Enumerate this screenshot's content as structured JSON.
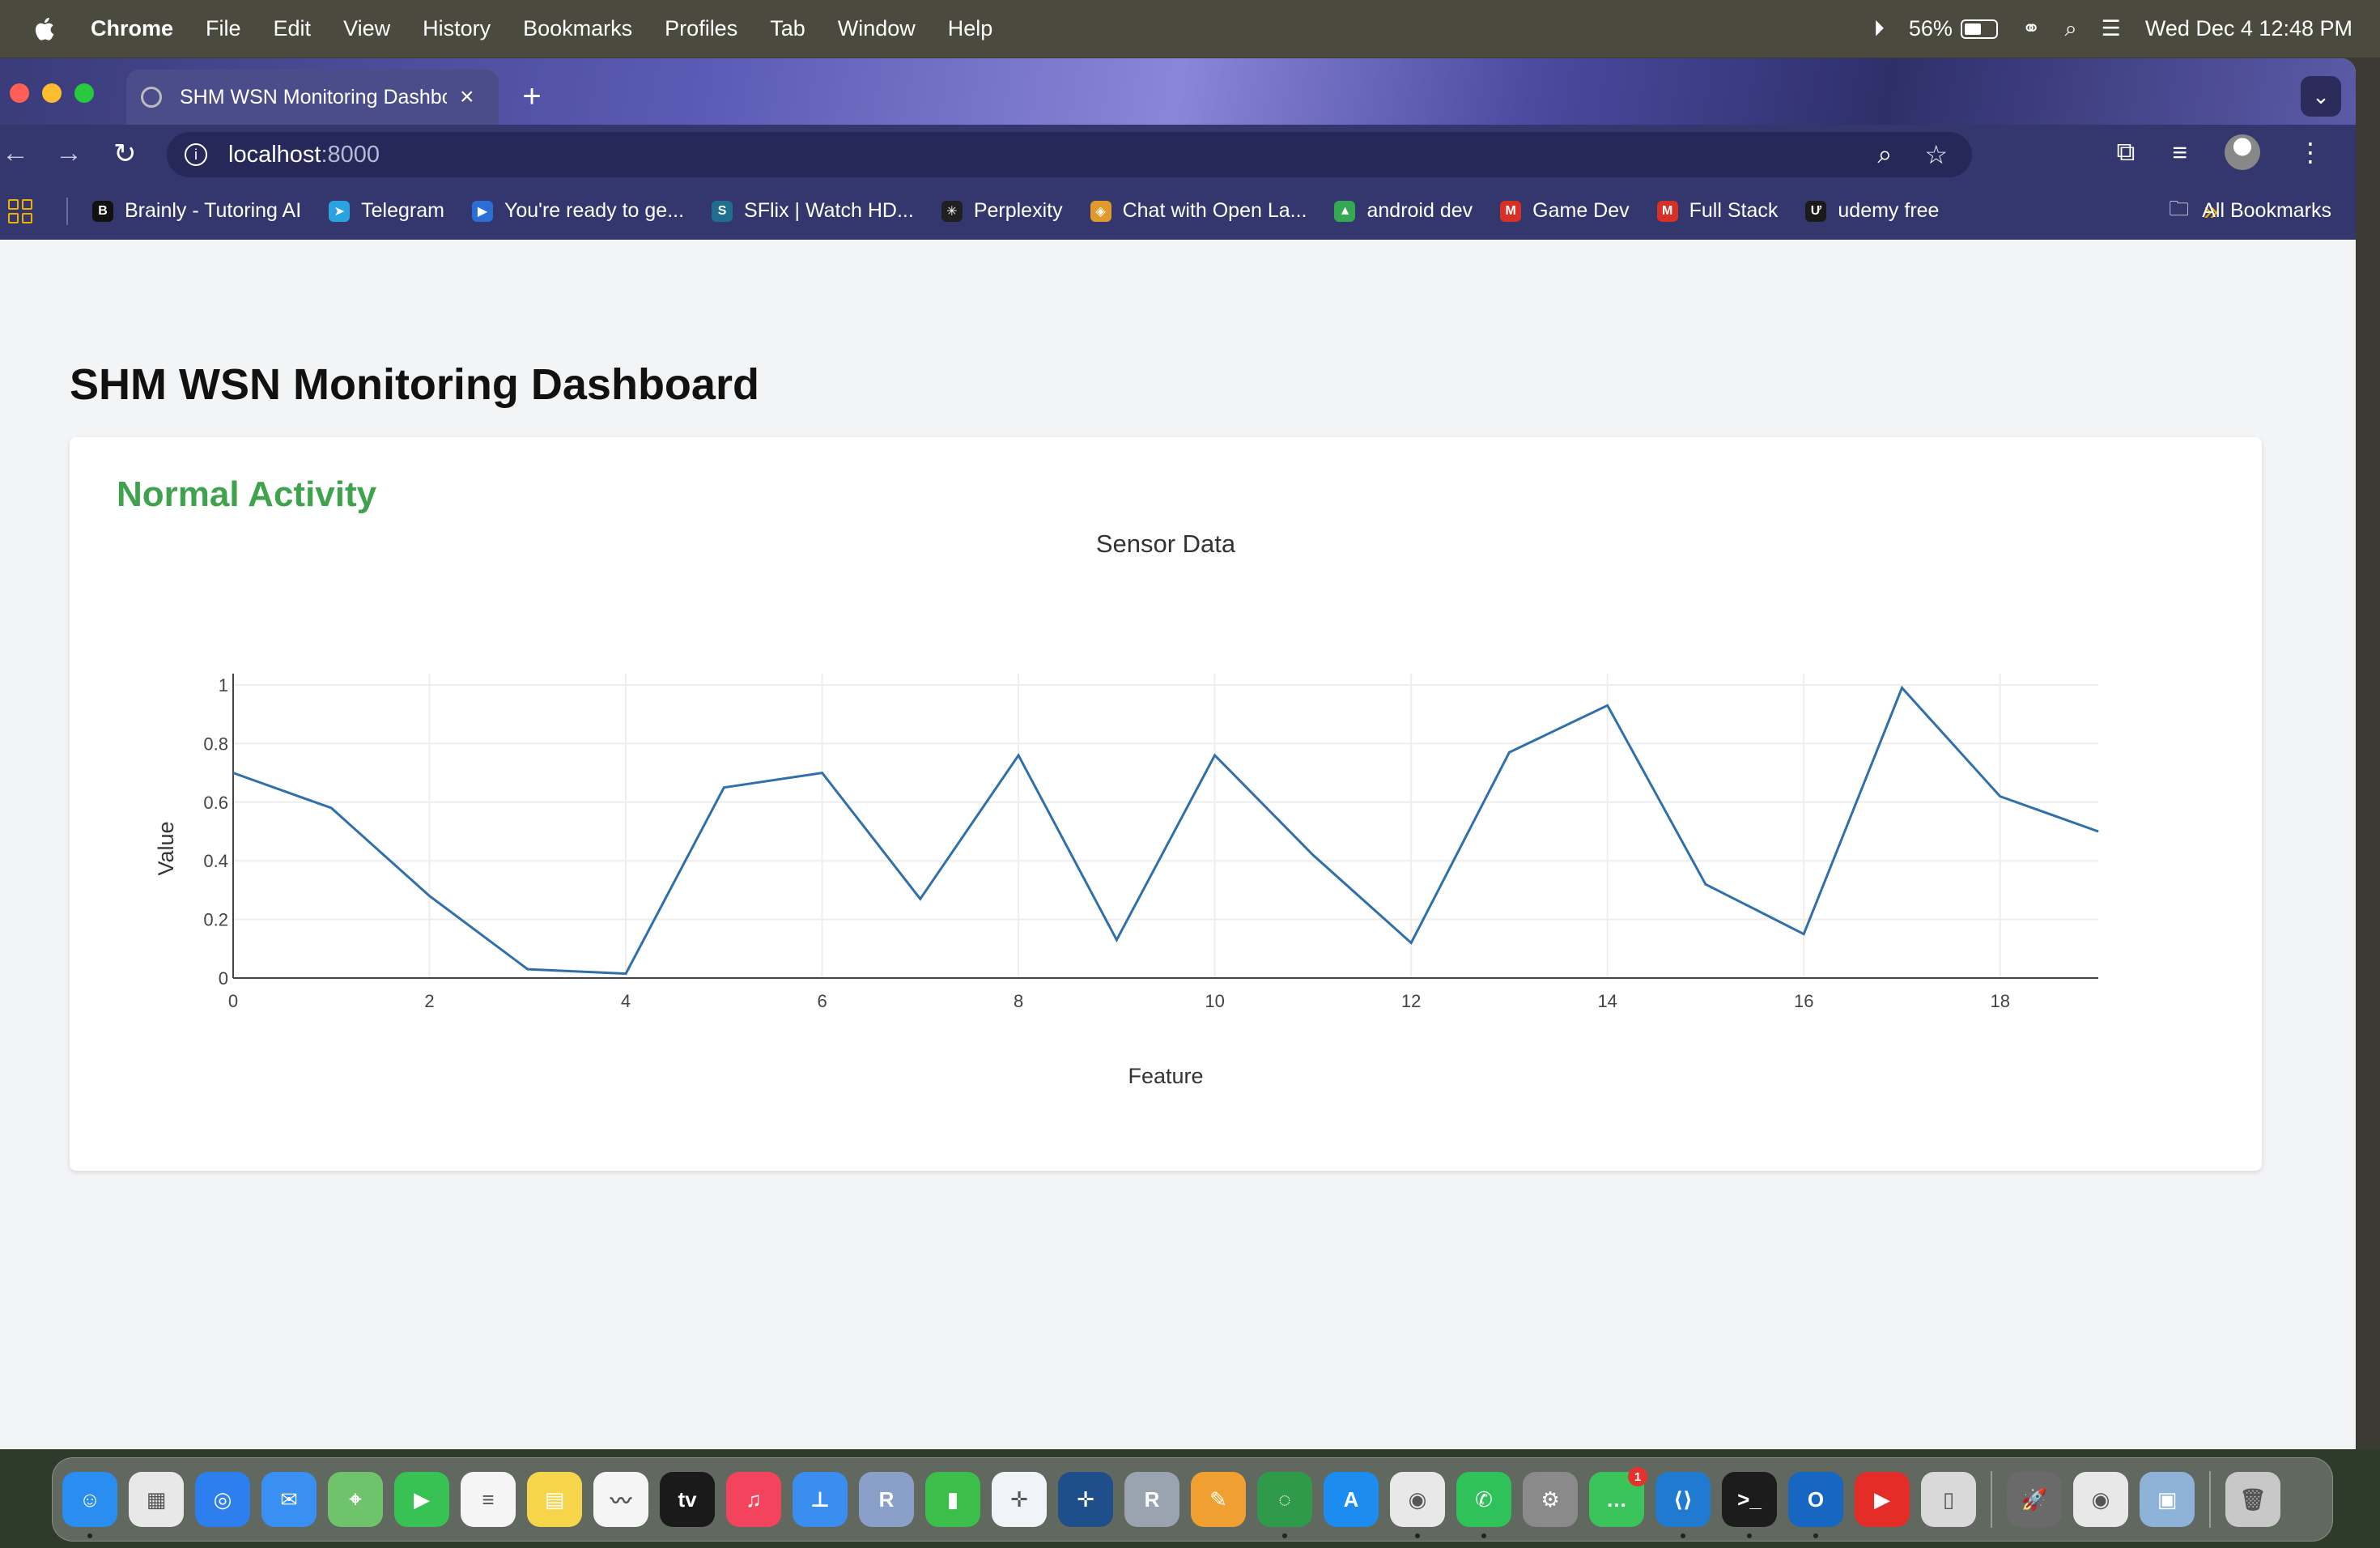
{
  "menubar": {
    "app_name": "Chrome",
    "items": [
      "File",
      "Edit",
      "View",
      "History",
      "Bookmarks",
      "Profiles",
      "Tab",
      "Window",
      "Help"
    ],
    "battery_percent": "56%",
    "battery_level": 0.56,
    "datetime": "Wed Dec 4  12:48 PM"
  },
  "browser": {
    "tab_title": "SHM WSN Monitoring Dashboard",
    "url_host": "localhost",
    "url_port": ":8000",
    "bookmarks": [
      {
        "label": "Brainly - Tutoring AI",
        "icon": "brainly-icon",
        "color": "#111111",
        "glyph": "B"
      },
      {
        "label": "Telegram",
        "icon": "telegram-icon",
        "color": "#2aa3e0",
        "glyph": "➤"
      },
      {
        "label": "You're ready to ge...",
        "icon": "video-icon",
        "color": "#2b6fd6",
        "glyph": "▶"
      },
      {
        "label": "SFlix | Watch HD...",
        "icon": "sflix-icon",
        "color": "#1e6f8f",
        "glyph": "S"
      },
      {
        "label": "Perplexity",
        "icon": "perplexity-icon",
        "color": "#202020",
        "glyph": "✳"
      },
      {
        "label": "Chat with Open La...",
        "icon": "openlayers-icon",
        "color": "#e09a2b",
        "glyph": "◈"
      },
      {
        "label": "android dev",
        "icon": "drive-icon",
        "color": "#34a853",
        "glyph": "▲"
      },
      {
        "label": "Game Dev",
        "icon": "gmail-icon",
        "color": "#d93025",
        "glyph": "M"
      },
      {
        "label": "Full Stack",
        "icon": "gmail-icon",
        "color": "#d93025",
        "glyph": "M"
      },
      {
        "label": "udemy free",
        "icon": "udemy-icon",
        "color": "#1a1a1a",
        "glyph": "Ư"
      }
    ],
    "overflow": "»",
    "all_bookmarks": "All Bookmarks"
  },
  "page": {
    "title": "SHM WSN Monitoring Dashboard",
    "status": "Normal Activity",
    "status_color": "#3fa34d"
  },
  "chart_data": {
    "type": "line",
    "title": "Sensor Data",
    "xlabel": "Feature",
    "ylabel": "Value",
    "xlim": [
      0,
      19
    ],
    "ylim": [
      0,
      1
    ],
    "x": [
      0,
      1,
      2,
      3,
      4,
      5,
      6,
      7,
      8,
      9,
      10,
      11,
      12,
      13,
      14,
      15,
      16,
      17,
      18,
      19
    ],
    "values": [
      0.7,
      0.58,
      0.28,
      0.03,
      0.015,
      0.65,
      0.7,
      0.27,
      0.76,
      0.13,
      0.76,
      0.42,
      0.12,
      0.77,
      0.93,
      0.32,
      0.15,
      0.99,
      0.62,
      0.5
    ],
    "x_ticks": [
      0,
      2,
      4,
      6,
      8,
      10,
      12,
      14,
      16,
      18
    ],
    "y_ticks": [
      0,
      0.2,
      0.4,
      0.6,
      0.8,
      1
    ],
    "y_tick_labels": [
      "0",
      "0.2",
      "0.4",
      "0.6",
      "0.8",
      "1"
    ],
    "line_color": "#3070aa",
    "grid": true
  },
  "dock": {
    "apps": [
      {
        "name": "finder-icon",
        "color": "#2a8df0",
        "glyph": "☺",
        "running": true
      },
      {
        "name": "launchpad-icon",
        "color": "#e8e8e8",
        "glyph": "▦",
        "running": false
      },
      {
        "name": "safari-icon",
        "color": "#2d7ff0",
        "glyph": "◎",
        "running": false
      },
      {
        "name": "mail-icon",
        "color": "#3a8ff2",
        "glyph": "✉",
        "running": false
      },
      {
        "name": "maps-icon",
        "color": "#6fc36a",
        "glyph": "⌖",
        "running": false
      },
      {
        "name": "facetime-icon",
        "color": "#38c254",
        "glyph": "▶",
        "running": false
      },
      {
        "name": "reminders-icon",
        "color": "#f5f5f5",
        "glyph": "≡",
        "running": false
      },
      {
        "name": "notes-icon",
        "color": "#f7d54a",
        "glyph": "▤",
        "running": false
      },
      {
        "name": "freeform-icon",
        "color": "#f5f5f5",
        "glyph": "〰",
        "running": false
      },
      {
        "name": "appletv-icon",
        "color": "#1a1a1a",
        "glyph": "tv",
        "running": false
      },
      {
        "name": "music-icon",
        "color": "#f4435c",
        "glyph": "♫",
        "running": false
      },
      {
        "name": "keynote-icon",
        "color": "#3b8df0",
        "glyph": "⊥",
        "running": false
      },
      {
        "name": "r-icon",
        "color": "#8aa0c8",
        "glyph": "R",
        "running": false
      },
      {
        "name": "numbers-icon",
        "color": "#3cbf4a",
        "glyph": "▮",
        "running": false
      },
      {
        "name": "tableau-icon",
        "color": "#f0f4f8",
        "glyph": "✛",
        "running": false
      },
      {
        "name": "tableau-prep-icon",
        "color": "#1f4f8a",
        "glyph": "✛",
        "running": false
      },
      {
        "name": "rstudio-icon",
        "color": "#9aa4b0",
        "glyph": "R",
        "running": false
      },
      {
        "name": "pages-icon",
        "color": "#f0a030",
        "glyph": "✎",
        "running": false
      },
      {
        "name": "sync-icon",
        "color": "#2f9b4a",
        "glyph": "◌",
        "running": true
      },
      {
        "name": "appstore-icon",
        "color": "#1c8cf0",
        "glyph": "A",
        "running": false
      },
      {
        "name": "chrome-icon",
        "color": "#e8e8e8",
        "glyph": "◉",
        "running": true
      },
      {
        "name": "whatsapp-icon",
        "color": "#2fc25a",
        "glyph": "✆",
        "running": true
      },
      {
        "name": "settings-icon",
        "color": "#8a8a8a",
        "glyph": "⚙",
        "running": false
      },
      {
        "name": "messages-icon",
        "color": "#3bc45a",
        "glyph": "…",
        "running": false,
        "badge": "1"
      },
      {
        "name": "vscode-icon",
        "color": "#1f7ad0",
        "glyph": "⟨⟩",
        "running": true
      },
      {
        "name": "terminal-icon",
        "color": "#1c1c1c",
        "glyph": ">_",
        "running": true
      },
      {
        "name": "outlook-icon",
        "color": "#1766c2",
        "glyph": "O",
        "running": true
      },
      {
        "name": "youtube-icon",
        "color": "#e52d27",
        "glyph": "▶",
        "running": false
      },
      {
        "name": "iphone-mirroring-icon",
        "color": "#d9d9d9",
        "glyph": "▯",
        "running": false
      },
      {
        "name": "rocket-icon",
        "color": "#6a6a6a",
        "glyph": "🚀",
        "running": false,
        "sep_before": true
      },
      {
        "name": "chrome-app-icon",
        "color": "#e8e8e8",
        "glyph": "◉",
        "running": false
      },
      {
        "name": "preview-icon",
        "color": "#8fb3d8",
        "glyph": "▣",
        "running": false
      },
      {
        "name": "trash-icon",
        "color": "#c8c8c8",
        "glyph": "🗑",
        "running": false,
        "sep_before": true
      }
    ]
  }
}
